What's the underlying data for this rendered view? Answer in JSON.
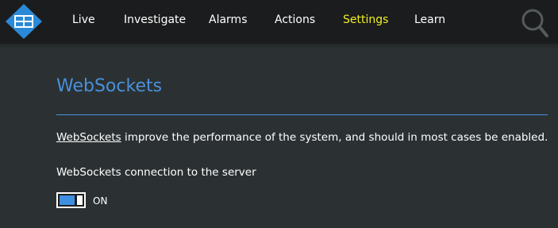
{
  "nav": {
    "items": [
      {
        "label": "Live",
        "active": false
      },
      {
        "label": "Investigate",
        "active": false
      },
      {
        "label": "Alarms",
        "active": false
      },
      {
        "label": "Actions",
        "active": false
      },
      {
        "label": "Settings",
        "active": true
      },
      {
        "label": "Learn",
        "active": false
      }
    ],
    "logo_icon": "grid-logo-icon",
    "search_icon": "search-icon"
  },
  "page": {
    "title": "WebSockets",
    "description_link": "WebSockets",
    "description_rest": " improve the performance of the system, and should in most cases be enabled.",
    "setting_label": "WebSockets connection to the server",
    "toggle_state": "ON",
    "toggle_on": true
  },
  "colors": {
    "topbar": "#1b1c1d",
    "background": "#2b3133",
    "accent": "#4a90d9",
    "active_nav": "#f0f025",
    "toggle_on": "#3e8fe0"
  }
}
